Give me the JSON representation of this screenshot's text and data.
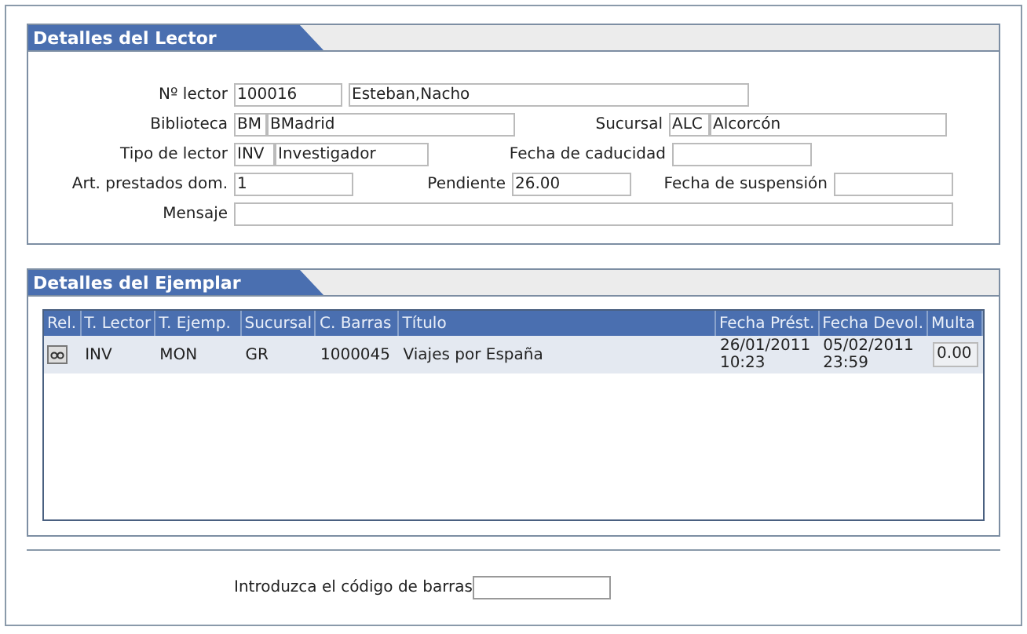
{
  "lector_panel": {
    "title": "Detalles del Lector",
    "fields": [
      {
        "label": "Nº lector",
        "code": "100016",
        "value": "Esteban,Nacho"
      },
      {
        "label": "Biblioteca",
        "code": "BM",
        "value": "BMadrid"
      },
      {
        "label": "Sucursal",
        "code": "ALC",
        "value": "Alcorcón"
      },
      {
        "label": "Tipo de lector",
        "code": "INV",
        "value": "Investigador"
      },
      {
        "label": "Fecha de caducidad"
      },
      {
        "label": "Art. prestados dom.",
        "value": "1"
      },
      {
        "label": "Pendiente",
        "value": "26.00"
      },
      {
        "label": "Fecha de suspensión"
      },
      {
        "label": "Mensaje"
      }
    ]
  },
  "ejemplar_panel": {
    "title": "Detalles del Ejemplar",
    "table": {
      "columns": [
        "Rel.",
        "T. Lector",
        "T. Ejemp.",
        "Sucursal",
        "C. Barras",
        "Título",
        "Fecha Prést.",
        "Fecha Devol.",
        "Multa"
      ],
      "rows": [
        {
          "cells": [
            "",
            "INV",
            "MON",
            "GR",
            "1000045",
            "Viajes por España",
            "26/01/2011 10:23",
            "05/02/2011 23:59",
            "0.00"
          ]
        }
      ]
    }
  },
  "barcode": {
    "label": "Introduzca el código de barras"
  }
}
